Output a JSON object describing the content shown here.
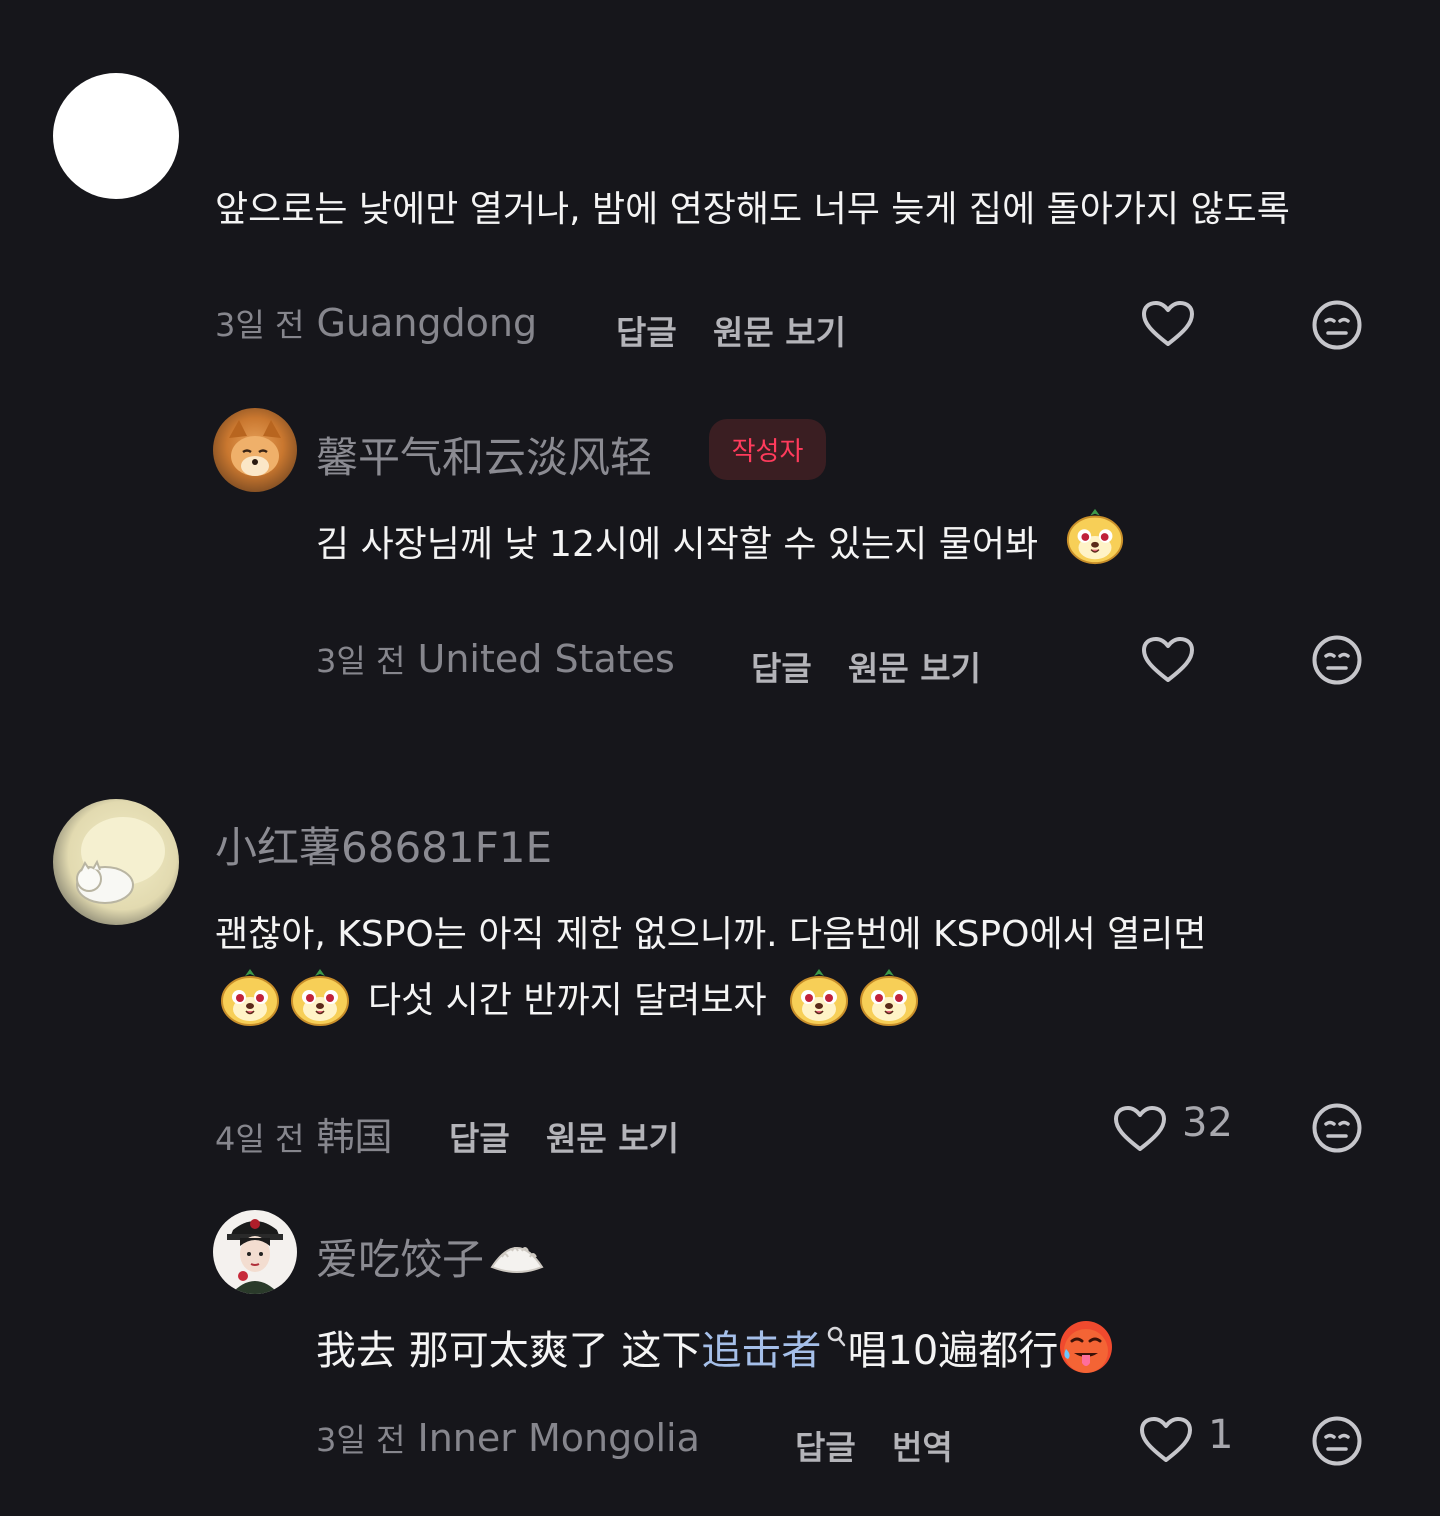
{
  "comments": [
    {
      "text": "앞으로는 낮에만 열거나, 밤에 연장해도 너무 늦게 집에 돌아가지 않도록",
      "time": "3일 전",
      "location": "Guangdong",
      "reply_label": "답글",
      "original_label": "원문 보기",
      "reply": {
        "username": "馨平气和云淡风轻",
        "author_badge": "작성자",
        "text": "김 사장님께 낮 12시에 시작할 수 있는지 물어봐",
        "time": "3일 전",
        "location": "United States",
        "reply_label": "답글",
        "original_label": "원문 보기"
      }
    },
    {
      "username": "小红薯68681F1E",
      "text_line1": "괜찮아, KSPO는 아직 제한 없으니까. 다음번에 KSPO에서 열리면",
      "text_line2": "다섯 시간 반까지 달려보자",
      "time": "4일 전",
      "location": "韩国",
      "reply_label": "답글",
      "original_label": "원문 보기",
      "likes": "32",
      "reply": {
        "username": "爱吃饺子",
        "text_part1": "我去 那可太爽了 这下 ",
        "link_text": "追击者",
        "text_part2": " 唱10遍都行",
        "time": "3일 전",
        "location": "Inner Mongolia",
        "reply_label": "답글",
        "translate_label": "번역",
        "likes": "1"
      }
    }
  ],
  "icons": {
    "like": "heart-outline-icon",
    "dislike": "meh-face-icon",
    "sticker": "yellow-dog-sticker",
    "search": "search-magnifier-icon",
    "dumpling": "dumpling-emoji",
    "hot_face": "hot-face-emoji"
  },
  "colors": {
    "background": "#16161b",
    "badge_text": "#ff3b5c",
    "link": "#a5bfe9"
  }
}
